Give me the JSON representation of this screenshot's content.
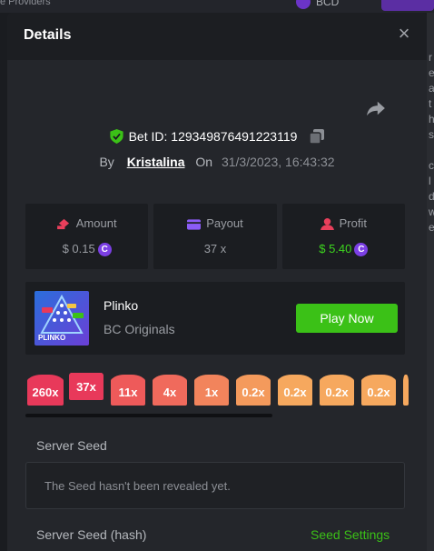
{
  "background": {
    "top_left_text": "e Providers",
    "currency": "BCD",
    "right_letters": [
      "r",
      "e",
      "a",
      "t",
      "h",
      "s",
      "",
      "c",
      "l",
      "d",
      "w",
      "e"
    ]
  },
  "modal": {
    "title": "Details",
    "close_label": "×"
  },
  "bet": {
    "id_label": "Bet ID: 129349876491223119",
    "by_label": "By",
    "user": "Kristalina",
    "on_label": "On",
    "date": "31/3/2023, 16:43:32"
  },
  "stats": [
    {
      "label": "Amount",
      "value": "$ 0.15",
      "icon": "amount-icon",
      "color": "#e83f5b"
    },
    {
      "label": "Payout",
      "value": "37 x",
      "icon": "payout-icon",
      "color": "#8b5cf6"
    },
    {
      "label": "Profit",
      "value": "$ 5.40",
      "icon": "profit-icon",
      "color": "#e83f5b"
    }
  ],
  "game": {
    "name": "Plinko",
    "provider": "BC Originals",
    "thumb_label": "PLINKO",
    "play_label": "Play Now"
  },
  "multipliers": [
    {
      "label": "260x",
      "color": "#e8395a"
    },
    {
      "label": "37x",
      "color": "#e8395a",
      "raised": true
    },
    {
      "label": "11x",
      "color": "#ee5a5a"
    },
    {
      "label": "4x",
      "color": "#f06a5c"
    },
    {
      "label": "1x",
      "color": "#f2845c"
    },
    {
      "label": "0.2x",
      "color": "#f49a5c"
    },
    {
      "label": "0.2x",
      "color": "#f6a85e"
    },
    {
      "label": "0.2x",
      "color": "#f6a85e"
    },
    {
      "label": "0.2x",
      "color": "#f6a85e"
    }
  ],
  "server_seed": {
    "label": "Server Seed",
    "message": "The Seed hasn't been revealed yet.",
    "hash_label": "Server Seed (hash)",
    "settings_label": "Seed Settings"
  }
}
